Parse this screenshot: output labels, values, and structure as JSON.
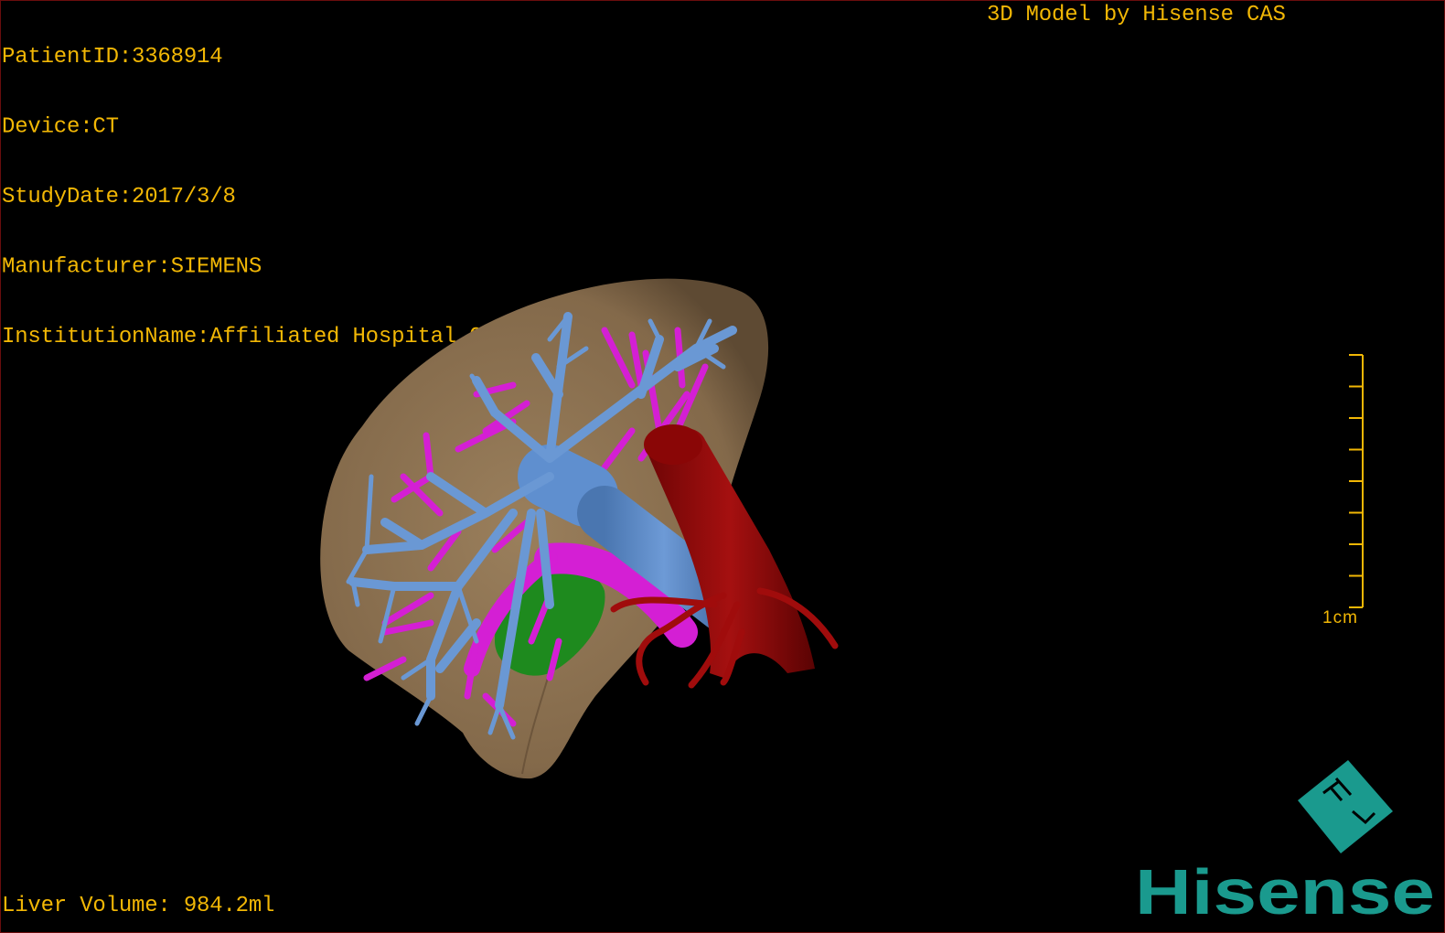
{
  "info": {
    "patient_id": "PatientID:3368914",
    "device": "Device:CT",
    "study_date": "StudyDate:2017/3/8",
    "manufacturer": "Manufacturer:SIEMENS",
    "institution": "InstitutionName:Affiliated Hospital Qingdao University-C"
  },
  "title": "3D Model by Hisense CAS",
  "liver_volume": "Liver Volume: 984.2ml",
  "scale_bar": {
    "label": "1cm",
    "ticks": 8
  },
  "logo": {
    "text": "Hisense",
    "mark": "HL",
    "color": "#1a9a8e"
  },
  "colors": {
    "overlay_text": "#f2b705",
    "liver": "#8c7352",
    "hepatic_vein": "#5f8fcf",
    "portal_vein": "#d41fd4",
    "artery": "#9a0a0a",
    "gallbladder": "#1e8a1e"
  }
}
